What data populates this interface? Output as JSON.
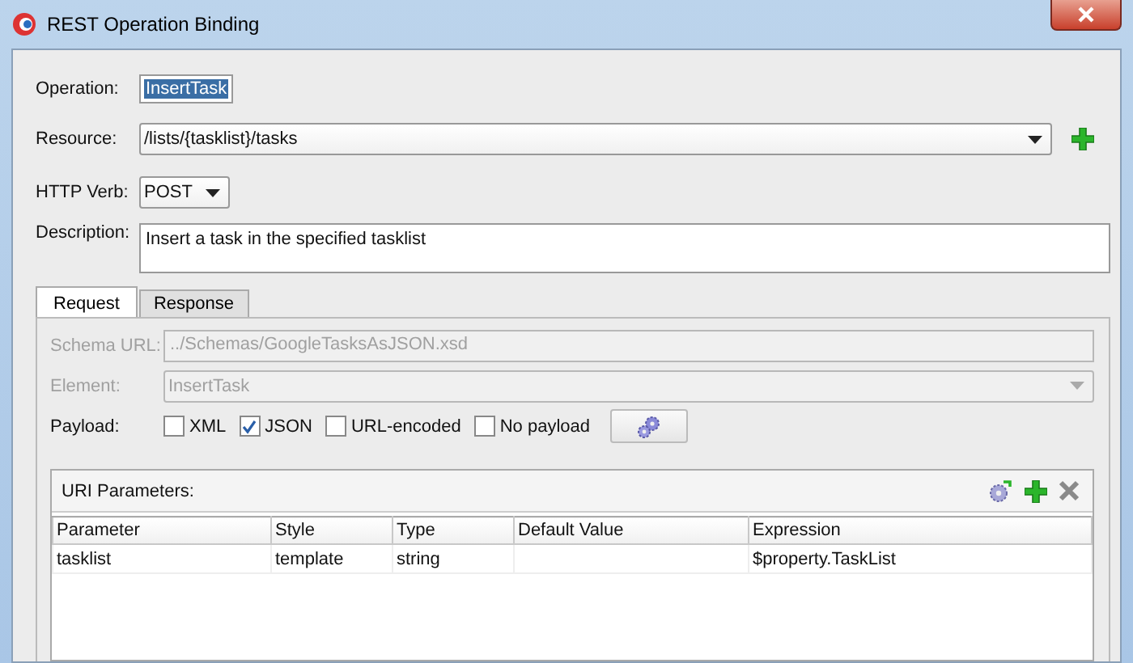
{
  "window": {
    "title": "REST Operation Binding"
  },
  "operation": {
    "label": "Operation:",
    "value": "InsertTask"
  },
  "resource": {
    "label": "Resource:",
    "value": "/lists/{tasklist}/tasks"
  },
  "http_verb": {
    "label": "HTTP Verb:",
    "value": "POST"
  },
  "description": {
    "label": "Description:",
    "value": "Insert a task in the specified tasklist"
  },
  "tabs": [
    {
      "label": "Request",
      "selected": true
    },
    {
      "label": "Response",
      "selected": false
    }
  ],
  "schema_url": {
    "label": "Schema URL:",
    "value": "../Schemas/GoogleTasksAsJSON.xsd",
    "disabled": true
  },
  "element": {
    "label": "Element:",
    "value": "InsertTask",
    "disabled": true
  },
  "payload": {
    "label": "Payload:",
    "options": [
      {
        "label": "XML",
        "checked": false
      },
      {
        "label": "JSON",
        "checked": true
      },
      {
        "label": "URL-encoded",
        "checked": false
      },
      {
        "label": "No payload",
        "checked": false
      }
    ]
  },
  "uri_parameters": {
    "title": "URI Parameters:",
    "columns": [
      "Parameter",
      "Style",
      "Type",
      "Default Value",
      "Expression"
    ],
    "rows": [
      [
        "tasklist",
        "template",
        "string",
        "",
        "$property.TaskList"
      ]
    ]
  }
}
